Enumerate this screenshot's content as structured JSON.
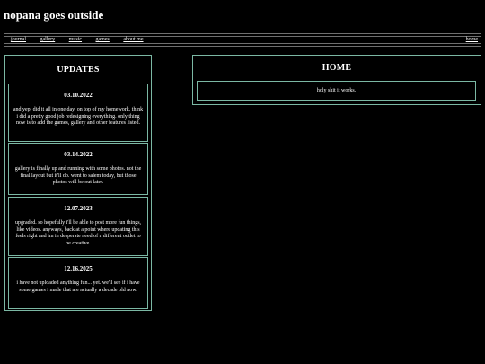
{
  "site": {
    "title": "nopana goes outside"
  },
  "nav": {
    "links": [
      {
        "label": "journal"
      },
      {
        "label": "gallery"
      },
      {
        "label": "music"
      },
      {
        "label": "games"
      },
      {
        "label": "about me"
      }
    ],
    "home_label": "home"
  },
  "updates": {
    "heading": "UPDATES",
    "items": [
      {
        "date": "03.10.2022",
        "text": "and yep, did it all in one day. on top of my homework. think i did a pretty good job redesigning everything. only thing now is to add the games, gallery and other features listed."
      },
      {
        "date": "03.14.2022",
        "text": "gallery is finally up and running with some photos. not the final layout but it'll do. went to salem today, but those photos will be out later."
      },
      {
        "date": "12.07.2023",
        "text": "upgraded. so hopefully i'll be able to post more fun things, like videos. anyways, back at a point where updating this feels right and im in desperate need of a different outlet to be creative."
      },
      {
        "date": "12.16.2025",
        "text": "i have not uploaded anything fun... yet. we'll see if i have some games i made that are actually a decade old now."
      }
    ]
  },
  "home": {
    "heading": "HOME",
    "message": "holy shit it works."
  },
  "colors": {
    "background": "#000000",
    "border_accent": "#7bb8a4",
    "text": "#ffffff"
  }
}
